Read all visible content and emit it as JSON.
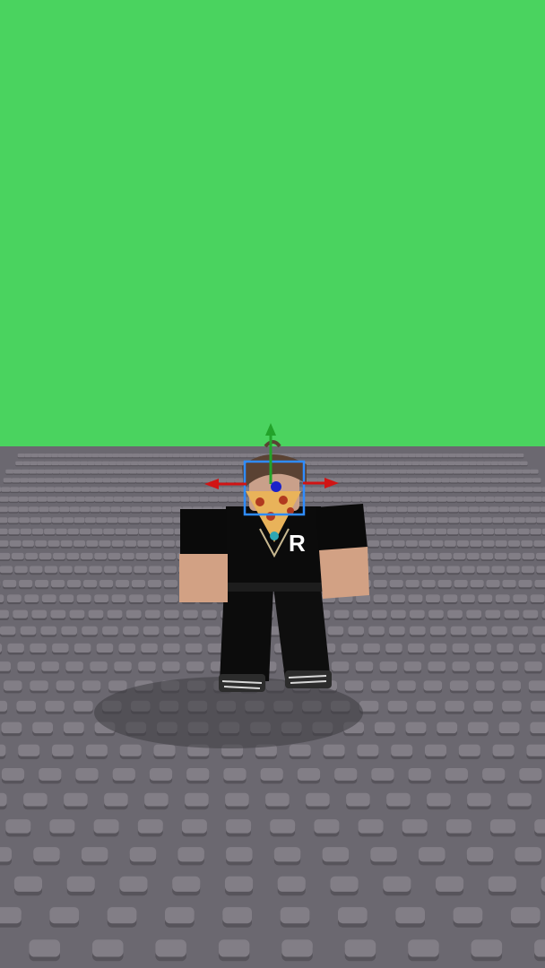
{
  "scene": {
    "sky_color": "#4ad35f",
    "ground_color": "#6b6870",
    "stud_color": "#827e86",
    "stud_shadow": "#57545b"
  },
  "avatar": {
    "shirt_letter": "R",
    "shirt_color": "#0b0b0b",
    "skin_color": "#d2a184",
    "hair_color": "#5a4233",
    "mask_color": "#e9b35a",
    "pepperoni_color": "#b13a1f"
  },
  "gizmo": {
    "x_axis_color": "#d11414",
    "y_axis_color": "#23a32a",
    "z_axis_color": "#1a22c9",
    "selection_color": "#2f8cff"
  }
}
